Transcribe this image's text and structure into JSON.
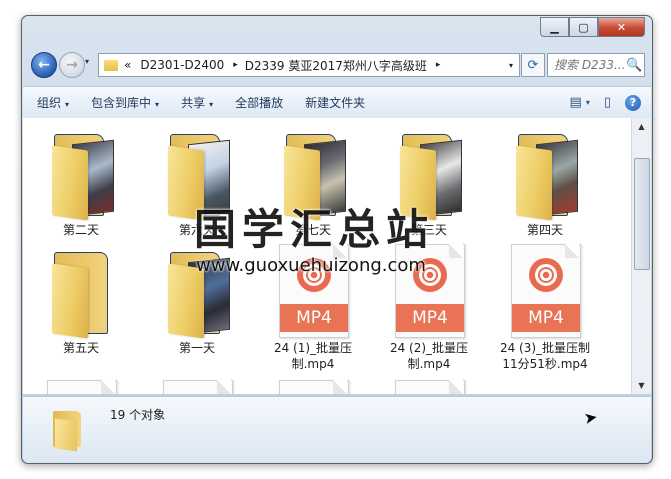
{
  "window": {
    "controls": {
      "minimize_icon": "minimize-icon",
      "maximize_icon": "maximize-icon",
      "close_icon": "close-icon",
      "minimize": "▁",
      "maximize": "▢",
      "close": "✕"
    }
  },
  "nav": {
    "back": "back-arrow-icon",
    "forward": "forward-arrow-icon",
    "history_caret": "▾",
    "path_overflow": "«",
    "breadcrumb": [
      "D2301-D2400",
      "D2339 莫亚2017郑州八字高级班"
    ],
    "separator": "▸",
    "dropdown": "▾",
    "refresh": "⟳",
    "search_placeholder": "搜索 D233...",
    "search_icon": "🔍"
  },
  "toolbar": {
    "items": [
      {
        "label": "组织",
        "caret": "▾"
      },
      {
        "label": "包含到库中",
        "caret": "▾"
      },
      {
        "label": "共享",
        "caret": "▾"
      },
      {
        "label": "全部播放",
        "caret": ""
      },
      {
        "label": "新建文件夹",
        "caret": ""
      }
    ],
    "view_icon": "▤",
    "view_caret": "▾",
    "pane_icon": "▯",
    "help": "?"
  },
  "files": [
    {
      "name": "第二天",
      "type": "folder",
      "thumb": "p1"
    },
    {
      "name": "第六天",
      "type": "folder",
      "thumb": "p2"
    },
    {
      "name": "第七天",
      "type": "folder",
      "thumb": "p3"
    },
    {
      "name": "第三天",
      "type": "folder",
      "thumb": "p4"
    },
    {
      "name": "第四天",
      "type": "folder",
      "thumb": "p5"
    },
    {
      "name": "第五天",
      "type": "folder",
      "thumb": "empty"
    },
    {
      "name": "第一天",
      "type": "folder",
      "thumb": "p6"
    },
    {
      "name": "24 (1)_批量压制.mp4",
      "type": "mp4",
      "ext": "MP4"
    },
    {
      "name": "24 (2)_批量压制.mp4",
      "type": "mp4",
      "ext": "MP4"
    },
    {
      "name": "24 (3)_批量压制11分51秒.mp4",
      "type": "mp4",
      "ext": "MP4"
    }
  ],
  "scrollbar": {
    "up": "▲",
    "down": "▼"
  },
  "details": {
    "count_text": "19 个对象"
  },
  "watermark": {
    "title": "国学汇总站",
    "url": "www.guoxuehuizong.com"
  },
  "cursor": "➤"
}
